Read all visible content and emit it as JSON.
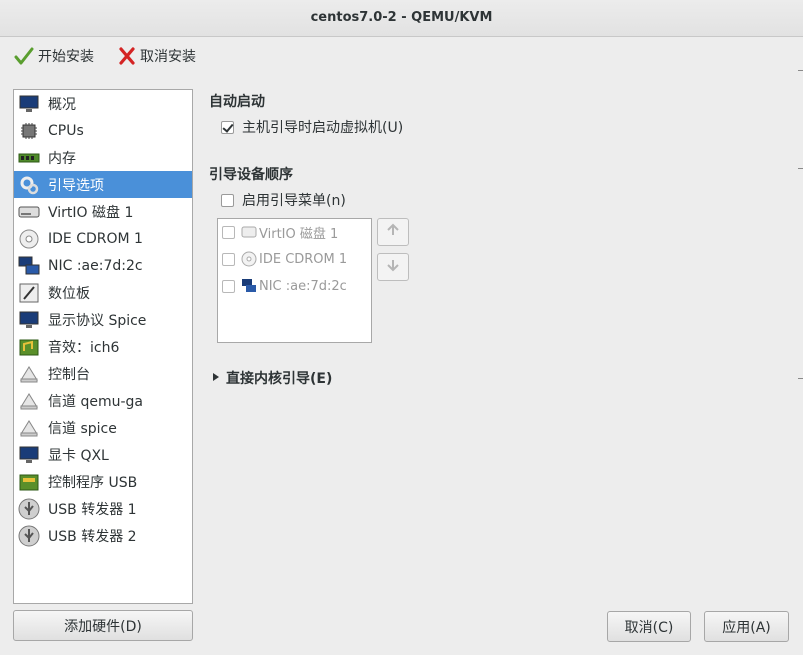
{
  "window": {
    "title": "centos7.0-2 - QEMU/KVM"
  },
  "toolbar": {
    "begin_install": "开始安装",
    "cancel_install": "取消安装"
  },
  "sidebar": {
    "items": [
      {
        "label": "概况",
        "icon": "overview-monitor-icon"
      },
      {
        "label": "CPUs",
        "icon": "cpu-icon"
      },
      {
        "label": "内存",
        "icon": "memory-icon"
      },
      {
        "label": "引导选项",
        "icon": "boot-options-icon",
        "selected": true
      },
      {
        "label": "VirtIO 磁盘 1",
        "icon": "disk-icon"
      },
      {
        "label": "IDE CDROM 1",
        "icon": "cdrom-icon"
      },
      {
        "label": "NIC :ae:7d:2c",
        "icon": "network-icon"
      },
      {
        "label": "数位板",
        "icon": "tablet-icon"
      },
      {
        "label": "显示协议 Spice",
        "icon": "display-icon"
      },
      {
        "label": "音效：ich6",
        "icon": "sound-icon"
      },
      {
        "label": "控制台",
        "icon": "console-icon"
      },
      {
        "label": "信道 qemu-ga",
        "icon": "channel-icon"
      },
      {
        "label": "信道 spice",
        "icon": "channel-icon"
      },
      {
        "label": "显卡 QXL",
        "icon": "video-card-icon"
      },
      {
        "label": "控制程序 USB",
        "icon": "controller-icon"
      },
      {
        "label": "USB 转发器 1",
        "icon": "usb-icon"
      },
      {
        "label": "USB 转发器 2",
        "icon": "usb-icon"
      }
    ]
  },
  "main": {
    "autostart": {
      "title": "自动启动",
      "checkbox_label": "主机引导时启动虚拟机(U)",
      "checked": true
    },
    "boot_order": {
      "title": "引导设备顺序",
      "menu_checkbox_label": "启用引导菜单(n)",
      "menu_checked": false,
      "devices": [
        {
          "label": "VirtIO 磁盘 1",
          "icon": "disk-icon"
        },
        {
          "label": "IDE CDROM 1",
          "icon": "cdrom-icon"
        },
        {
          "label": "NIC :ae:7d:2c",
          "icon": "network-icon"
        }
      ]
    },
    "direct_kernel_boot": {
      "label": "直接内核引导(E)",
      "expanded": false
    }
  },
  "buttons": {
    "add_hardware": "添加硬件(D)",
    "cancel": "取消(C)",
    "apply": "应用(A)"
  }
}
